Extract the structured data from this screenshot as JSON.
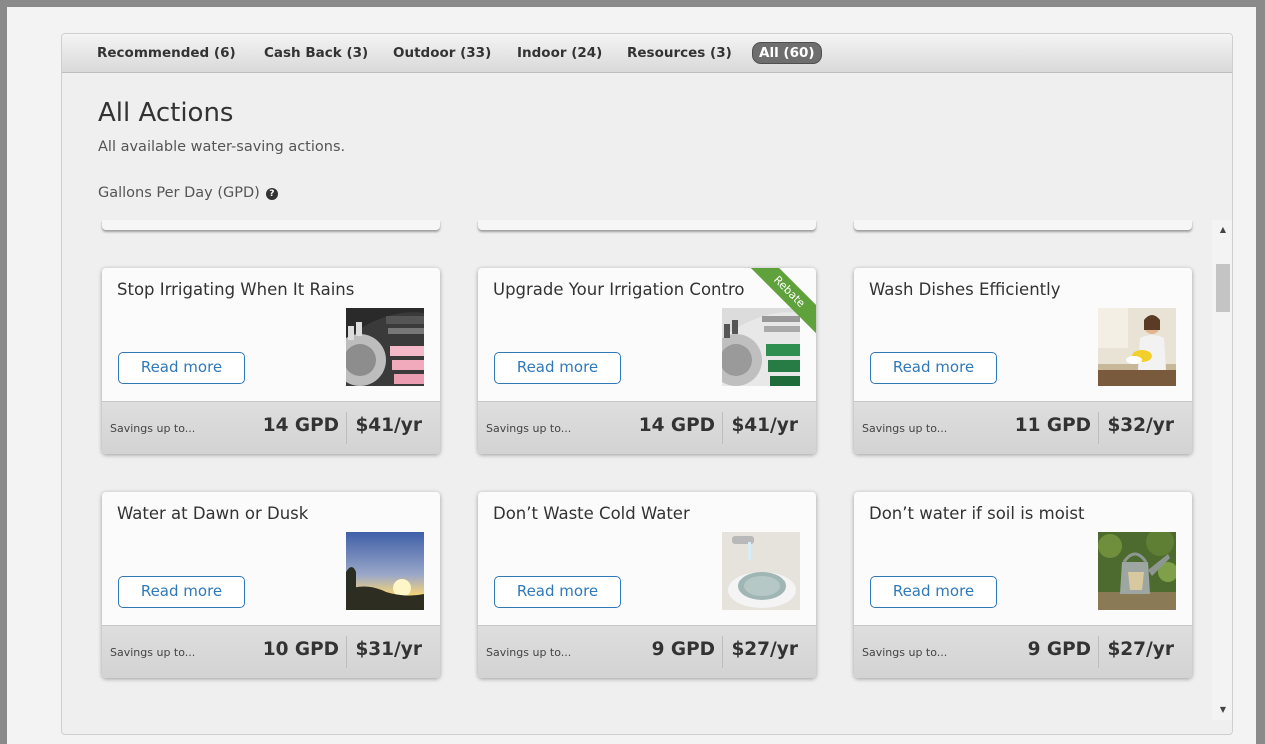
{
  "tabs": [
    {
      "label": "Recommended (6)",
      "active": false
    },
    {
      "label": "Cash Back (3)",
      "active": false
    },
    {
      "label": "Outdoor (33)",
      "active": false
    },
    {
      "label": "Indoor (24)",
      "active": false
    },
    {
      "label": "Resources (3)",
      "active": false
    },
    {
      "label": "All (60)",
      "active": true
    }
  ],
  "page": {
    "title": "All Actions",
    "subtitle": "All available water-saving actions.",
    "gpd_label": "Gallons Per Day (GPD)",
    "help_icon": "question-circle-icon"
  },
  "cards": [
    {
      "title": "Stop Irrigating When It Rains",
      "read_more": "Read more",
      "savings_label": "Savings up to...",
      "gpd": "14 GPD",
      "dollars": "$41/yr",
      "badge": "",
      "image": "irrigation-controller-dial"
    },
    {
      "title": "Upgrade Your Irrigation Contro",
      "read_more": "Read more",
      "savings_label": "Savings up to...",
      "gpd": "14 GPD",
      "dollars": "$41/yr",
      "badge": "Rebate",
      "image": "irrigation-controller-dial"
    },
    {
      "title": "Wash Dishes Efficiently",
      "read_more": "Read more",
      "savings_label": "Savings up to...",
      "gpd": "11 GPD",
      "dollars": "$32/yr",
      "badge": "",
      "image": "woman-washing-dishes"
    },
    {
      "title": "Water at Dawn or Dusk",
      "read_more": "Read more",
      "savings_label": "Savings up to...",
      "gpd": "10 GPD",
      "dollars": "$31/yr",
      "badge": "",
      "image": "sunrise"
    },
    {
      "title": "Don’t Waste Cold Water",
      "read_more": "Read more",
      "savings_label": "Savings up to...",
      "gpd": "9 GPD",
      "dollars": "$27/yr",
      "badge": "",
      "image": "faucet-bowl"
    },
    {
      "title": "Don’t water if soil is moist",
      "read_more": "Read more",
      "savings_label": "Savings up to...",
      "gpd": "9 GPD",
      "dollars": "$27/yr",
      "badge": "",
      "image": "watering-can"
    }
  ],
  "colors": {
    "accent": "#3079b9",
    "rebate": "#5fa13a",
    "active_tab": "#6e6e6e"
  }
}
